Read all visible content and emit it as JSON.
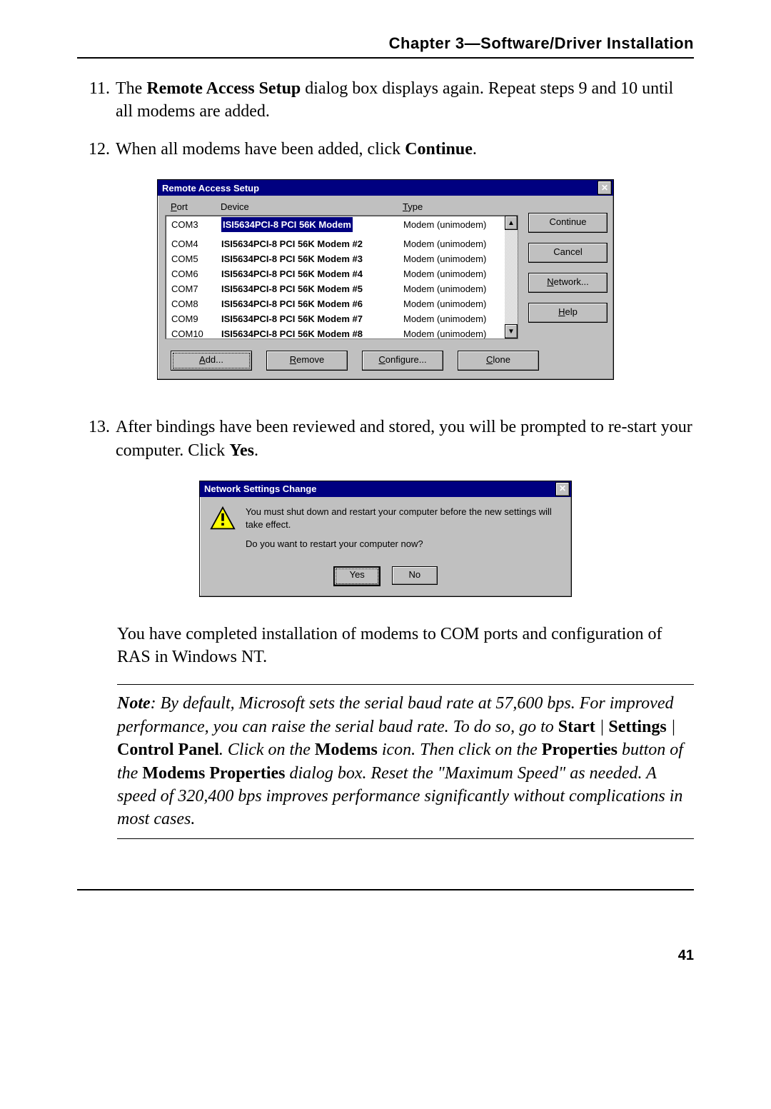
{
  "chapter_heading": "Chapter 3—Software/Driver Installation",
  "steps": {
    "s11": {
      "num": "11.",
      "t1": "The ",
      "b1": "Remote Access Setup",
      "t2": " dialog box displays again.  Repeat steps 9 and 10 until all modems are added."
    },
    "s12": {
      "num": "12.",
      "t1": "When all modems have been added, click ",
      "b1": "Continue",
      "t2": "."
    },
    "s13": {
      "num": "13.",
      "t1": "After bindings have been reviewed and stored, you will be prompted to re-start your computer.  Click ",
      "b1": "Yes",
      "t2": "."
    }
  },
  "ras": {
    "title": "Remote Access Setup",
    "headers": {
      "port_u": "P",
      "port_rest": "ort",
      "device": "Device",
      "type_u": "T",
      "type_rest": "ype"
    },
    "rows": [
      {
        "port": "COM3",
        "device": "ISI5634PCI-8 PCI 56K Modem",
        "type": "Modem (unimodem)"
      },
      {
        "port": "COM4",
        "device": "ISI5634PCI-8 PCI 56K Modem #2",
        "type": "Modem (unimodem)"
      },
      {
        "port": "COM5",
        "device": "ISI5634PCI-8 PCI 56K Modem #3",
        "type": "Modem (unimodem)"
      },
      {
        "port": "COM6",
        "device": "ISI5634PCI-8 PCI 56K Modem #4",
        "type": "Modem (unimodem)"
      },
      {
        "port": "COM7",
        "device": "ISI5634PCI-8 PCI 56K Modem #5",
        "type": "Modem (unimodem)"
      },
      {
        "port": "COM8",
        "device": "ISI5634PCI-8 PCI 56K Modem #6",
        "type": "Modem (unimodem)"
      },
      {
        "port": "COM9",
        "device": "ISI5634PCI-8 PCI 56K Modem #7",
        "type": "Modem (unimodem)"
      },
      {
        "port": "COM10",
        "device": "ISI5634PCI-8 PCI 56K Modem #8",
        "type": "Modem (unimodem)"
      }
    ],
    "right_buttons": {
      "continue": "Continue",
      "cancel": "Cancel",
      "network_u": "N",
      "network_rest": "etwork...",
      "help_u": "H",
      "help_rest": "elp"
    },
    "bottom_buttons": {
      "add_u": "A",
      "add_rest": "dd...",
      "remove_u": "R",
      "remove_rest": "emove",
      "configure_u": "C",
      "configure_rest": "onfigure...",
      "clone_u": "C",
      "clone_rest": "lone"
    }
  },
  "msg": {
    "title": "Network Settings Change",
    "line1": "You must shut down and restart your computer before the new settings will take effect.",
    "line2": "Do you want to restart your computer now?",
    "yes_u": "Y",
    "yes_rest": "es",
    "no_u": "N",
    "no_rest": "o"
  },
  "after_para": "You have completed installation of modems to COM ports and configuration of RAS in Windows NT.",
  "note": {
    "lead_i": "Note",
    "t1": ": By default, Microsoft sets the serial baud rate at 57,600 bps.  For improved performance, you can raise the serial baud rate.  To do so, go to ",
    "b1": "Start",
    "sep1": " | ",
    "b2": "Settings",
    "sep2": " | ",
    "b3": "Control Panel",
    "t2": ".  Click on the ",
    "b4": "Modems",
    "t3": " icon.  Then click on the ",
    "b5": "Properties",
    "t4": " button of the ",
    "b6": "Modems Properties",
    "t5": " dialog box.  Reset the \"Maximum Speed\" as needed.  A speed of 320,400 bps improves performance significantly without complications in most cases."
  },
  "page_number": "41"
}
